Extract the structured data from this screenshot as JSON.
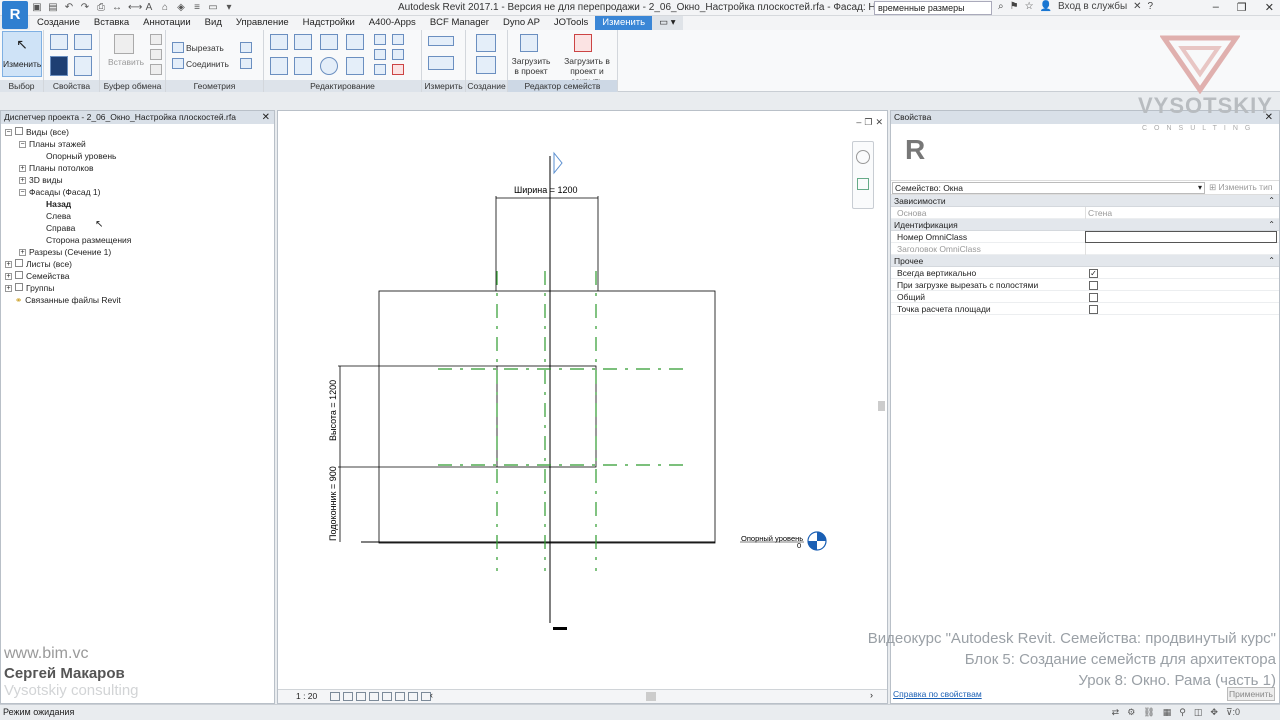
{
  "app": {
    "logo_letter": "R",
    "title": "Autodesk Revit 2017.1 - Версия не для перепродажи -    2_06_Окно_Настройка плоскостей.rfa - Фасад: Назад",
    "search_value": "временные размеры",
    "login_label": "Вход в службы",
    "accent_color": "#3a86d6"
  },
  "ribbon": {
    "tabs": [
      {
        "label": "Создание"
      },
      {
        "label": "Вставка"
      },
      {
        "label": "Аннотации"
      },
      {
        "label": "Вид"
      },
      {
        "label": "Управление"
      },
      {
        "label": "Надстройки"
      },
      {
        "label": "A400-Apps"
      },
      {
        "label": "BCF Manager"
      },
      {
        "label": "Dyno AP"
      },
      {
        "label": "JOTools"
      },
      {
        "label": "Изменить"
      }
    ],
    "modify_label": "Изменить",
    "paste_label": "Вставить",
    "cut_label": "Вырезать",
    "join_label": "Соединить",
    "load_label": "Загрузить в проект",
    "load_close_label": "Загрузить в проект и закрыть",
    "groups": {
      "select": "Выбор",
      "properties": "Свойства",
      "clipboard": "Буфер обмена",
      "geometry": "Геометрия",
      "modify": "Редактирование",
      "measure": "Измерить",
      "create": "Создание",
      "family_editor": "Редактор семейств"
    }
  },
  "project_browser": {
    "title": "Диспетчер проекта - 2_06_Окно_Настройка плоскостей.rfa",
    "items": [
      {
        "label": "Виды (все)"
      },
      {
        "label": "Планы этажей"
      },
      {
        "label": "Опорный уровень"
      },
      {
        "label": "Планы потолков"
      },
      {
        "label": "3D виды"
      },
      {
        "label": "Фасады (Фасад 1)"
      },
      {
        "label": "Назад"
      },
      {
        "label": "Слева"
      },
      {
        "label": "Справа"
      },
      {
        "label": "Сторона размещения"
      },
      {
        "label": "Разрезы (Сечение 1)"
      },
      {
        "label": "Листы (все)"
      },
      {
        "label": "Семейства"
      },
      {
        "label": "Группы"
      },
      {
        "label": "Связанные файлы Revit"
      }
    ]
  },
  "watermark": {
    "url": "www.bim.vc",
    "author": "Сергей Макаров",
    "company": "Vysotskiy consulting",
    "brand": "VYSOTSKIY",
    "brand_sub": "CONSULTING",
    "course_line1": "Видеокурс \"Autodesk Revit. Семейства: продвинутый курс\"",
    "course_line2": "Блок 5: Создание семейств для архитектора",
    "course_line3": "Урок 8: Окно. Рама (часть 1)"
  },
  "view": {
    "dim_width": "Ширина = 1200",
    "dim_height": "Высота = 1200",
    "dim_sill": "Подоконник = 900",
    "level_name": "Опорный уровень",
    "level_value": "0",
    "scale": "1 : 20",
    "line_color": "#000000",
    "ref_plane_color": "#2e9b2e"
  },
  "properties": {
    "title": "Свойства",
    "family": "Семейство: Окна",
    "edit_type": "Изменить тип",
    "sections": {
      "constraints": "Зависимости",
      "identity": "Идентификация",
      "other": "Прочее"
    },
    "rows": {
      "host_name": "Основа",
      "host_value": "Стена",
      "omni_number": "Номер OmniClass",
      "omni_title": "Заголовок OmniClass",
      "always_vertical": "Всегда вертикально",
      "cut_with_voids": "При загрузке вырезать с полостями",
      "shared": "Общий",
      "room_calc": "Точка расчета площади"
    },
    "help_link": "Справка по свойствам",
    "apply": "Применить"
  },
  "status": {
    "text": "Режим ожидания",
    "filter_count": ":0"
  }
}
